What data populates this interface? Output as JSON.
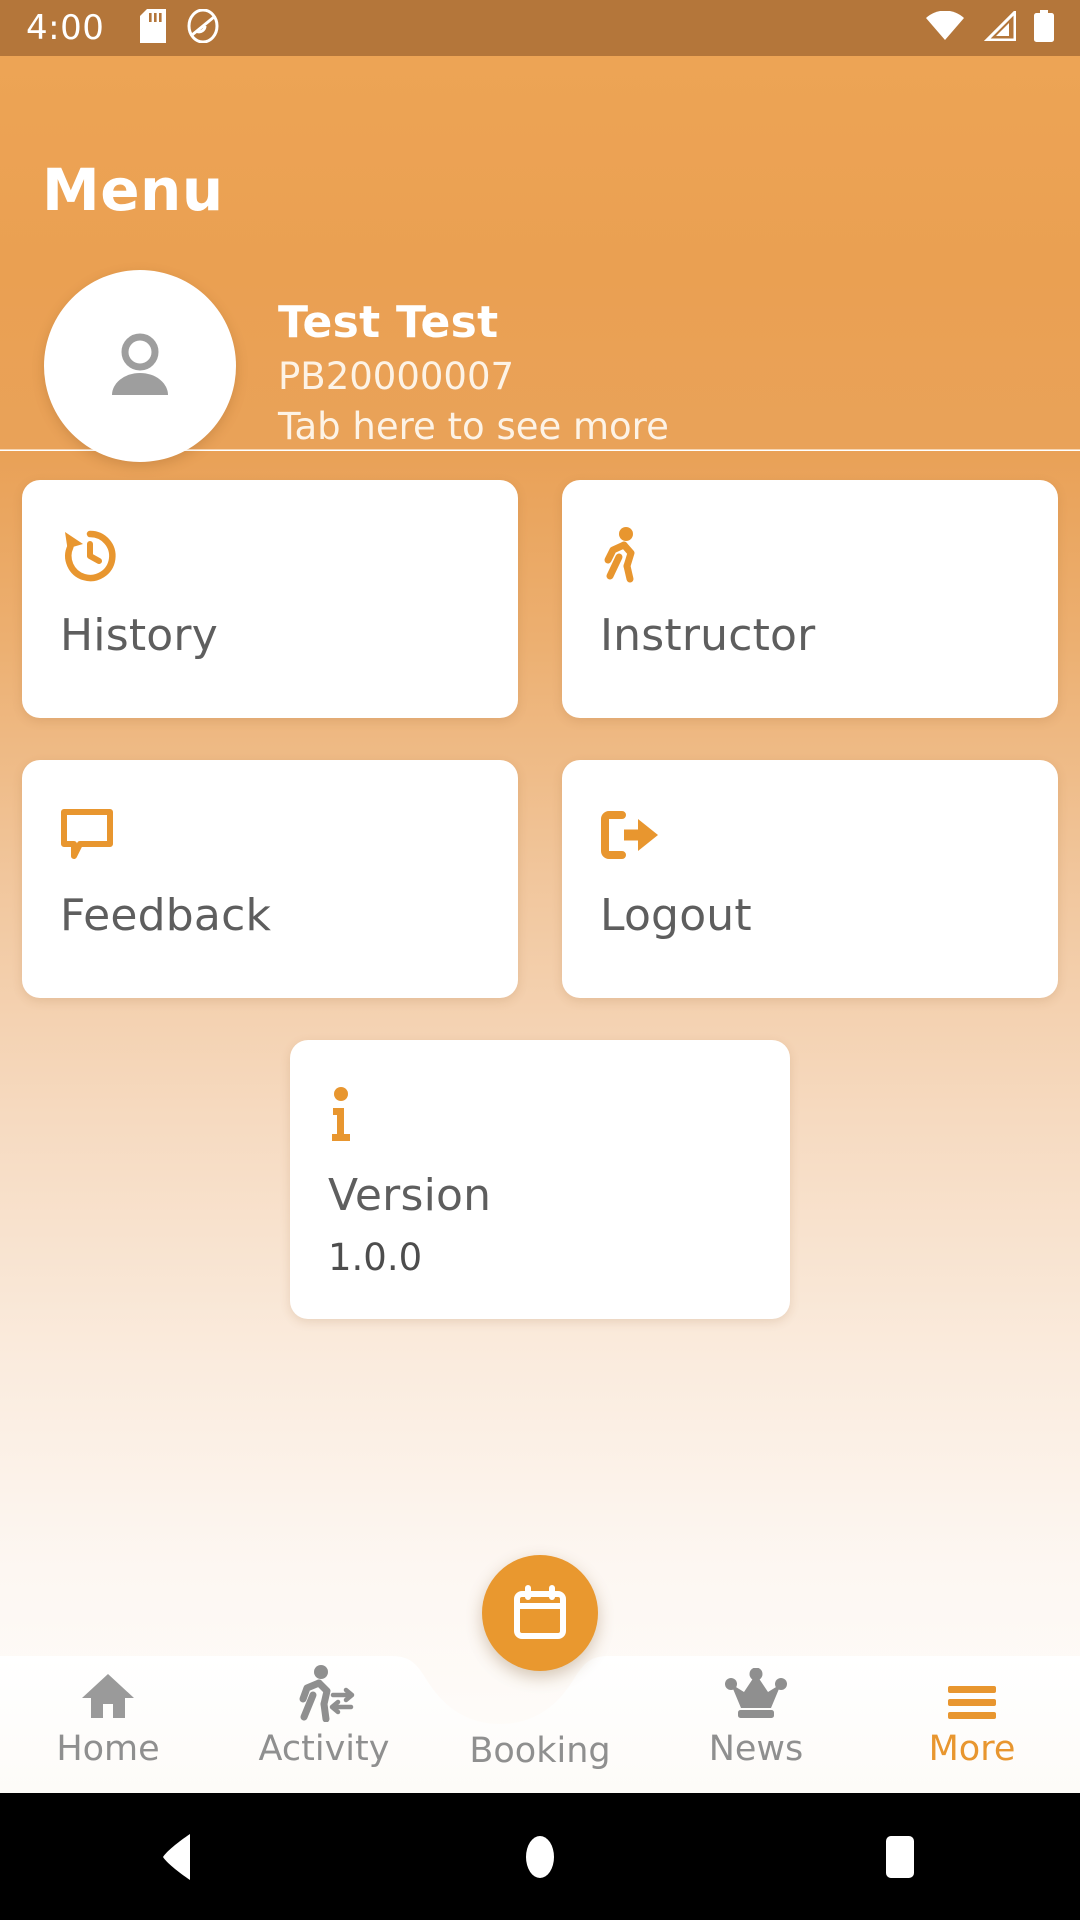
{
  "status_bar": {
    "time": "4:00",
    "icons_left": [
      "sd-card-icon",
      "do-not-disturb-icon"
    ],
    "icons_right": [
      "wifi-icon",
      "cell-signal-icon",
      "battery-full-icon"
    ],
    "background_color": "#B4763A"
  },
  "header": {
    "title": "Menu",
    "background_color": "#EAA052",
    "profile": {
      "avatar_icon": "person-icon",
      "name": "Test Test",
      "member_id": "PB20000007",
      "hint": "Tab here to see more"
    }
  },
  "menu": {
    "cards": [
      {
        "icon": "history-clock-icon",
        "label": "History"
      },
      {
        "icon": "walking-person-icon",
        "label": "Instructor"
      },
      {
        "icon": "speech-bubble-icon",
        "label": "Feedback"
      },
      {
        "icon": "logout-arrow-icon",
        "label": "Logout"
      }
    ],
    "version_card": {
      "icon": "info-icon",
      "label": "Version",
      "value": "1.0.0"
    },
    "accent_color": "#E8962F",
    "card_background": "#FFFFFF",
    "card_text_color": "#5E5E5E"
  },
  "bottom_nav": {
    "items": [
      {
        "icon": "home-icon",
        "label": "Home",
        "active": false
      },
      {
        "icon": "activity-walk-icon",
        "label": "Activity",
        "active": false
      },
      {
        "icon": "calendar-icon",
        "label": "Booking",
        "active": false
      },
      {
        "icon": "crown-icon",
        "label": "News",
        "active": false
      },
      {
        "icon": "hamburger-menu-icon",
        "label": "More",
        "active": true
      }
    ],
    "fab": {
      "icon": "calendar-icon",
      "color": "#E9982F"
    },
    "active_color": "#E8962F",
    "inactive_color": "#8F8F8F"
  },
  "system_nav": {
    "buttons": [
      "back-button",
      "home-button",
      "recents-button"
    ],
    "background_color": "#000000"
  }
}
